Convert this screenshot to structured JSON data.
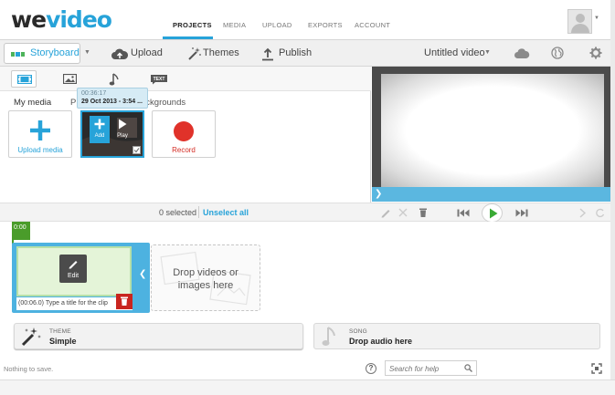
{
  "brand": {
    "logo_we": "we",
    "logo_video": "video"
  },
  "nav": {
    "items": [
      {
        "label": "PROJECTS"
      },
      {
        "label": "MEDIA"
      },
      {
        "label": "UPLOAD"
      },
      {
        "label": "EXPORTS"
      },
      {
        "label": "ACCOUNT"
      }
    ],
    "active": "PROJECTS"
  },
  "toolbar": {
    "storyboard_label": "Storyboard",
    "upload_label": "Upload",
    "themes_label": "Themes",
    "publish_label": "Publish",
    "project_title": "Untitled video"
  },
  "media": {
    "sub_tabs": [
      "My media",
      "P",
      "ackgrounds"
    ],
    "tiles": {
      "upload_label": "Upload media",
      "record_label": "Record",
      "video_add_label": "Add",
      "video_play_label": "Play"
    },
    "tooltip": {
      "duration": "00:36:17",
      "date": "29 Oct 2013 - 3:54 ..."
    }
  },
  "transport": {
    "selected_count": "0 selected",
    "unselect_label": "Unselect all"
  },
  "timeline": {
    "time_marker": "0:00",
    "clip_edit_label": "Edit",
    "clip_title": "(00:06.0) Type a title for the clip",
    "drop_text_1": "Drop videos or",
    "drop_text_2": "images here"
  },
  "theme": {
    "caption": "THEME",
    "value": "Simple"
  },
  "song": {
    "caption": "SONG",
    "value": "Drop audio here"
  },
  "footer": {
    "save_status": "Nothing to save.",
    "help_glyph": "?",
    "search_placeholder": "Search for help"
  },
  "colors": {
    "accent": "#27a3d9",
    "record": "#d42c24",
    "timeline_green": "#4a9c2a",
    "play_green": "#3aaa35"
  }
}
